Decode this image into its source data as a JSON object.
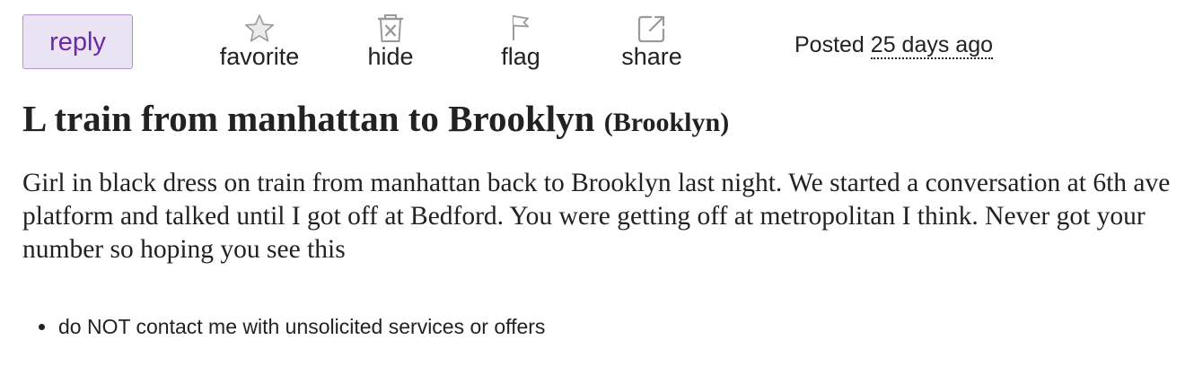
{
  "actions": {
    "reply_label": "reply",
    "favorite": {
      "label": "favorite",
      "icon": "star-icon"
    },
    "hide": {
      "label": "hide",
      "icon": "hide-icon"
    },
    "flag": {
      "label": "flag",
      "icon": "flag-icon"
    },
    "share": {
      "label": "share",
      "icon": "share-icon"
    }
  },
  "posted": {
    "prefix": "Posted",
    "time": "25 days ago"
  },
  "post": {
    "title": "L train from manhattan to Brooklyn",
    "location": "(Brooklyn)",
    "body": "Girl in black dress on train from manhattan back to Brooklyn last night. We started a conversation at 6th ave platform and talked until I got off at Bedford. You were getting off at metropolitan I think. Never got your number so hoping you see this"
  },
  "notices": [
    "do NOT contact me with unsolicited services or offers"
  ],
  "colors": {
    "reply_background": "#eae3f3",
    "reply_border": "#b291d0",
    "reply_text": "#6a2aa8",
    "icon_gray": "#999999",
    "text": "#222222"
  }
}
